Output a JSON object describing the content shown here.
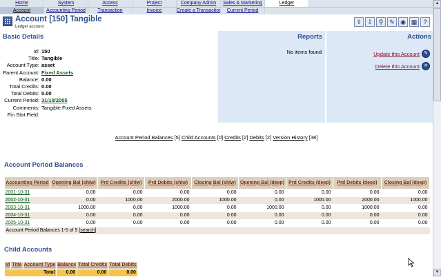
{
  "nav": {
    "row1": [
      "Home",
      "System",
      "Access",
      "Project",
      "Company Admin",
      "Sales & Marketing",
      "Ledger"
    ],
    "row2": [
      "Account",
      "Accounting Period",
      "Transaction",
      "Invoice",
      "Create a Transaction",
      "Current Period"
    ],
    "selected_row1": "Ledger",
    "active_row2": "Account"
  },
  "header": {
    "title": "Account [150] Tangible",
    "subtitle": "Ledger account",
    "toolbar_icons": [
      "up-arrow-icon",
      "down-arrow-icon",
      "search-icon",
      "edit-icon",
      "view-icon",
      "layers-icon",
      "help-icon"
    ]
  },
  "basic": {
    "title": "Basic Details",
    "rows": [
      {
        "label": "Id:",
        "value": "150",
        "link": false
      },
      {
        "label": "Title:",
        "value": "Tangible",
        "link": false
      },
      {
        "label": "Account Type:",
        "value": "asset",
        "link": false
      },
      {
        "label": "Parent Account:",
        "value": "Fixed Assets",
        "link": true
      },
      {
        "label": "Balance:",
        "value": "0.00",
        "link": false
      },
      {
        "label": "Total Credits:",
        "value": "0.00",
        "link": false
      },
      {
        "label": "Total Debits:",
        "value": "0.00",
        "link": false
      },
      {
        "label": "Current Period:",
        "value": "31/10/2005",
        "link": true
      },
      {
        "label": "Comments:",
        "value": "Tangible Fixed Assets",
        "link": false,
        "plain": true
      },
      {
        "label": "Fin Stat Field:",
        "value": "",
        "link": false
      }
    ]
  },
  "reports": {
    "title": "Reports",
    "empty": "No items found"
  },
  "actions": {
    "title": "Actions",
    "update": "Update this Account",
    "delete": "Delete this Account"
  },
  "subnav": [
    {
      "label": "Account Period Balances",
      "count": "[5]"
    },
    {
      "label": "Child Accounts",
      "count": "[0]"
    },
    {
      "label": "Credits",
      "count": "[2]"
    },
    {
      "label": "Debits",
      "count": "[2]"
    },
    {
      "label": "Version History",
      "count": "[38]"
    }
  ],
  "apb": {
    "title": "Account Period Balances",
    "headers": [
      "Accounting Period",
      "Opening Bal (shlw)",
      "Prd Credits (shlw)",
      "Prd Debits (shlw)",
      "Closing Bal (shlw)",
      "Opening Bal (deep)",
      "Prd Credits (deep)",
      "Prd Debits (deep)",
      "Closing Bal (deep)"
    ],
    "rows": [
      [
        "2001-10-31",
        "0.00",
        "0.00",
        "0.00",
        "0.00",
        "0.00",
        "0.00",
        "0.00",
        "0.00"
      ],
      [
        "2002-10-31",
        "0.00",
        "1000.00",
        "2000.00",
        "1000.00",
        "0.00",
        "1000.00",
        "2000.00",
        "1000.00"
      ],
      [
        "2003-10-31",
        "1000.00",
        "0.00",
        "1000.00",
        "0.00",
        "1000.00",
        "0.00",
        "1000.00",
        "0.00"
      ],
      [
        "2004-10-31",
        "0.00",
        "0.00",
        "0.00",
        "0.00",
        "0.00",
        "0.00",
        "0.00",
        "0.00"
      ],
      [
        "2005-10-31",
        "0.00",
        "0.00",
        "0.00",
        "0.00",
        "0.00",
        "0.00",
        "0.00",
        "0.00"
      ]
    ],
    "footer_text": "Account Period Balances 1-5 of 5",
    "footer_link": "search"
  },
  "child": {
    "title": "Child Accounts",
    "headers": [
      "Id",
      "Title",
      "Account Type",
      "Balance",
      "Total Credits",
      "Total Debits"
    ],
    "total_label": "Total",
    "totals": [
      "0.00",
      "0.00",
      "0.00"
    ]
  }
}
